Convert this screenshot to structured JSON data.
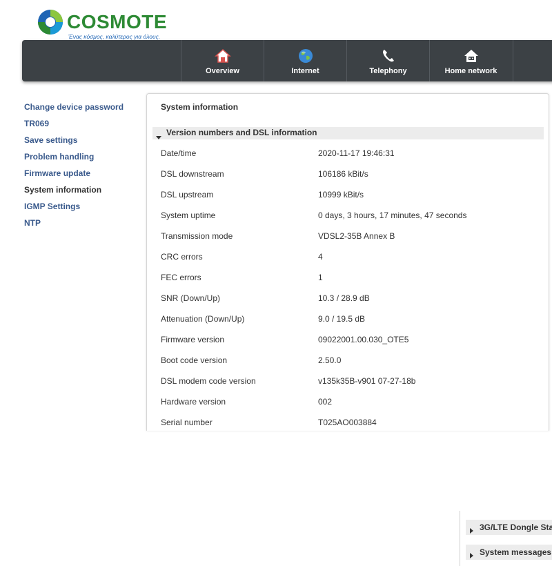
{
  "brand": {
    "name": "COSMOTE",
    "tagline": "Ένας κόσμος, καλύτερος για όλους."
  },
  "nav": {
    "items": [
      {
        "label": "Overview",
        "icon": "home-icon"
      },
      {
        "label": "Internet",
        "icon": "globe-icon"
      },
      {
        "label": "Telephony",
        "icon": "phone-icon"
      },
      {
        "label": "Home network",
        "icon": "home-network-icon"
      }
    ]
  },
  "sidebar": {
    "items": [
      {
        "label": "Change device password"
      },
      {
        "label": "TR069"
      },
      {
        "label": "Save settings"
      },
      {
        "label": "Problem handling"
      },
      {
        "label": "Firmware update"
      },
      {
        "label": "System information",
        "active": true
      },
      {
        "label": "IGMP Settings"
      },
      {
        "label": "NTP"
      }
    ]
  },
  "main": {
    "title": "System information",
    "section_title": "Version numbers and DSL information",
    "rows": [
      {
        "label": "Date/time",
        "value": "2020-11-17 19:46:31"
      },
      {
        "label": "DSL downstream",
        "value": "106186 kBit/s"
      },
      {
        "label": "DSL upstream",
        "value": "10999 kBit/s"
      },
      {
        "label": "System uptime",
        "value": "0 days, 3 hours, 17 minutes, 47 seconds"
      },
      {
        "label": "Transmission mode",
        "value": "VDSL2-35B Annex B"
      },
      {
        "label": "CRC errors",
        "value": "4"
      },
      {
        "label": "FEC errors",
        "value": "1"
      },
      {
        "label": "SNR (Down/Up)",
        "value": "10.3 / 28.9 dB"
      },
      {
        "label": "Attenuation (Down/Up)",
        "value": "9.0 / 19.5 dB"
      },
      {
        "label": "Firmware version",
        "value": "09022001.00.030_OTE5"
      },
      {
        "label": "Boot code version",
        "value": "2.50.0"
      },
      {
        "label": "DSL modem code version",
        "value": "v135k35B-v901 07-27-18b"
      },
      {
        "label": "Hardware version",
        "value": "002"
      },
      {
        "label": "Serial number",
        "value": "T025AO003884"
      }
    ]
  },
  "dock": {
    "items": [
      {
        "label": "3G/LTE Dongle Sta"
      },
      {
        "label": "System messages"
      }
    ]
  },
  "colors": {
    "navbar": "#3c4145",
    "link": "#3a5a8c",
    "brand_green": "#2d8a34",
    "brand_blue": "#1e64b4"
  }
}
